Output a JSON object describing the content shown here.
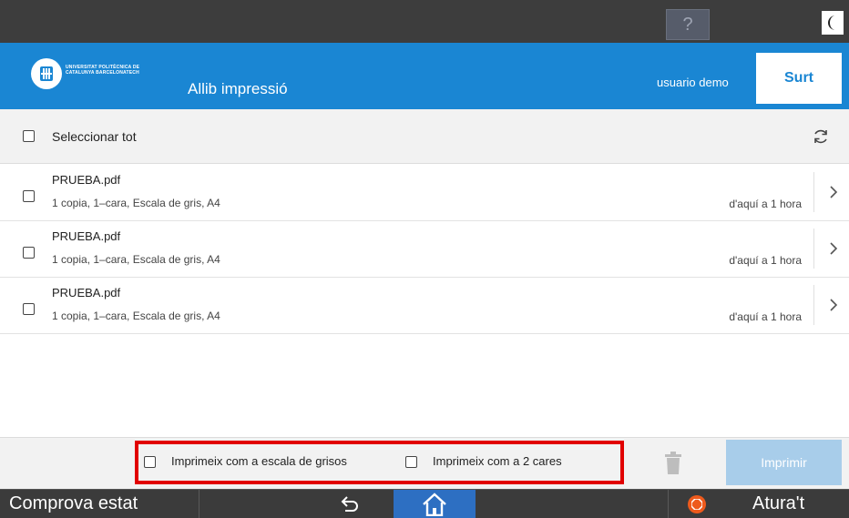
{
  "system_bar": {
    "help_label": "?",
    "help_icon": "question-icon",
    "night_icon": "moon-icon"
  },
  "header": {
    "logo_text": "UNIVERSITAT POLITÈCNICA DE CATALUNYA BARCELONATECH",
    "title": "Allib impressió",
    "user": "usuario demo",
    "logout_label": "Surt",
    "accent_color": "#1a86d3"
  },
  "list": {
    "select_all_label": "Seleccionar tot",
    "refresh_icon": "refresh-icon",
    "jobs": [
      {
        "name": "PRUEBA.pdf",
        "details": "1 copia, 1–cara, Escala de gris, A4",
        "time": "d'aquí a 1 hora"
      },
      {
        "name": "PRUEBA.pdf",
        "details": "1 copia, 1–cara, Escala de gris, A4",
        "time": "d'aquí a 1 hora"
      },
      {
        "name": "PRUEBA.pdf",
        "details": "1 copia, 1–cara, Escala de gris, A4",
        "time": "d'aquí a 1 hora"
      }
    ]
  },
  "options": {
    "grayscale_label": "Imprimeix com a escala de grisos",
    "duplex_label": "Imprimeix com a 2 cares",
    "print_label": "Imprimir",
    "highlight_color": "#e10000"
  },
  "device_bar": {
    "status_label": "Comprova estat",
    "stop_label": "Atura't",
    "home_color": "#2d6fc2"
  }
}
